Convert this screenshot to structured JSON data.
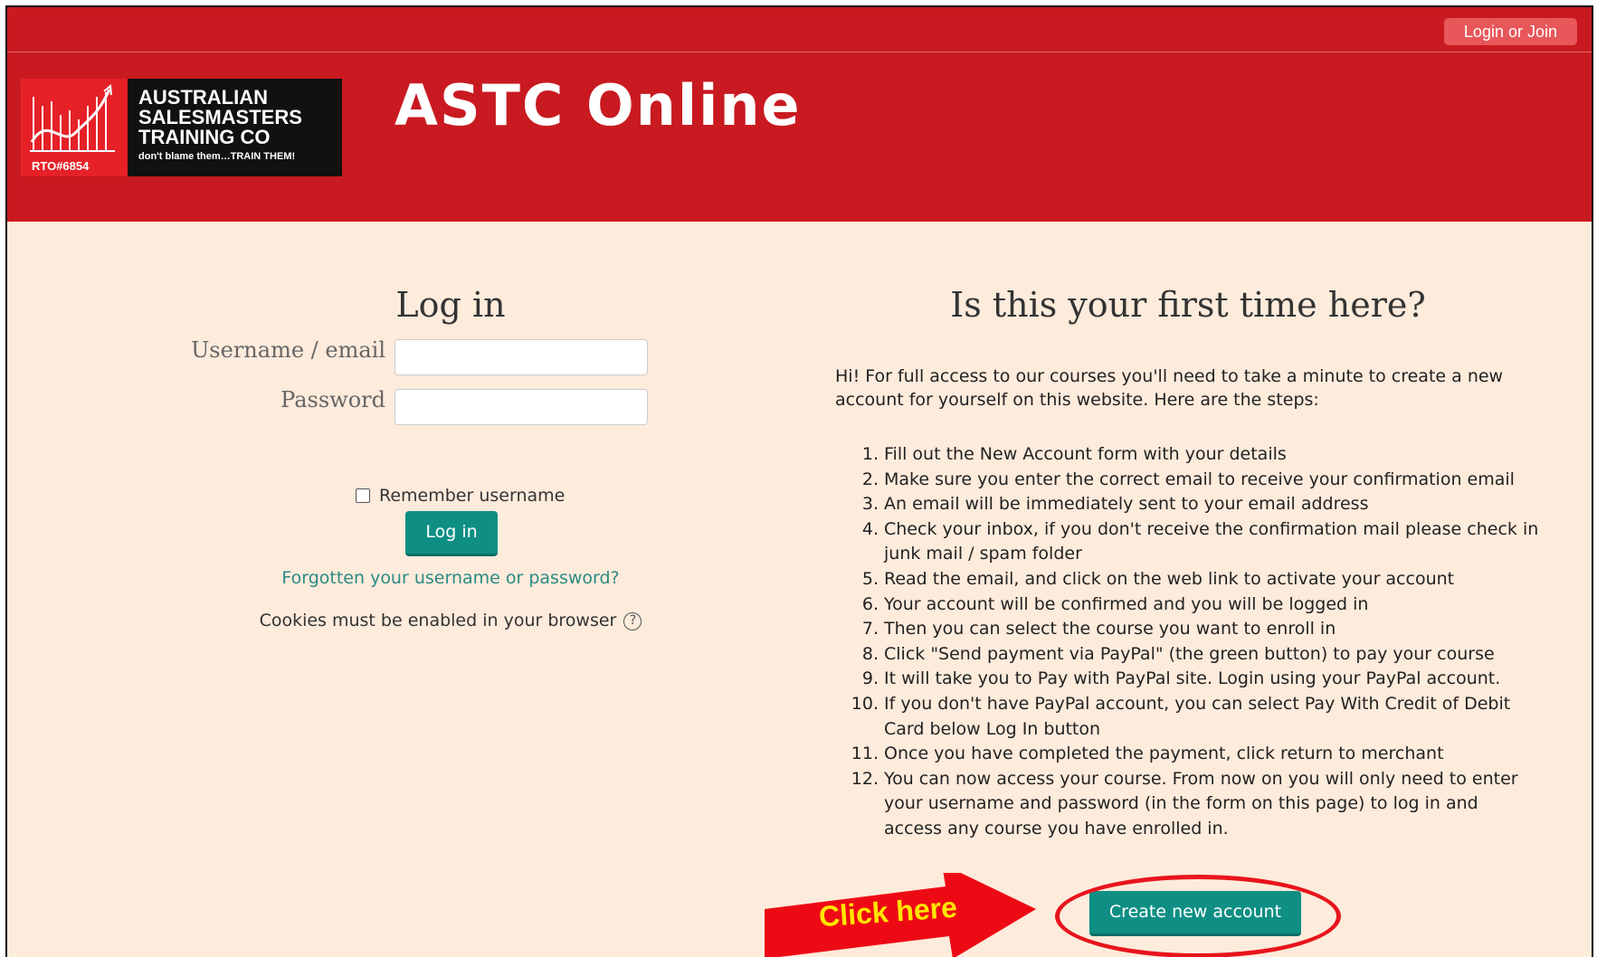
{
  "header": {
    "login_join": "Login or Join",
    "logo_lines": [
      "AUSTRALIAN",
      "SALESMASTERS",
      "TRAINING CO"
    ],
    "logo_tag": "don't blame them…TRAIN THEM!",
    "logo_rto": "RTO#6854",
    "site_title": "ASTC Online",
    "color": "#c81a20"
  },
  "login": {
    "heading": "Log in",
    "username_label": "Username / email",
    "password_label": "Password",
    "remember_label": "Remember username",
    "login_button": "Log in",
    "forgot_link": "Forgotten your username or password?",
    "cookies_text": "Cookies must be enabled in your browser"
  },
  "signup": {
    "heading": "Is this your first time here?",
    "intro": "Hi! For full access to our courses you'll need to take a minute to create a new account for yourself on this website. Here are the steps:",
    "steps": [
      "Fill out the New Account form with your details",
      "Make sure you enter the correct email to receive your confirmation email",
      "An email will be immediately sent to your email address",
      "Check your inbox, if you don't receive the confirmation mail please check in junk mail / spam folder",
      "Read the email, and click on the web link to activate your account",
      "Your account will be confirmed and you will be logged in",
      "Then you can select the course you want to enroll in",
      "Click \"Send payment via PayPal\" (the green button) to pay your course",
      "It will take you to Pay with PayPal site. Login using your PayPal account.",
      "If you don't have PayPal account, you can select Pay With Credit of Debit Card below Log In button",
      "Once you have completed the payment, click return to merchant",
      "You can now access your course. From now on you will only need to enter your username and password (in the form on this page) to log in and access any course you have enrolled in."
    ],
    "create_button": "Create new account"
  },
  "annotation": {
    "click_here": "Click here"
  }
}
